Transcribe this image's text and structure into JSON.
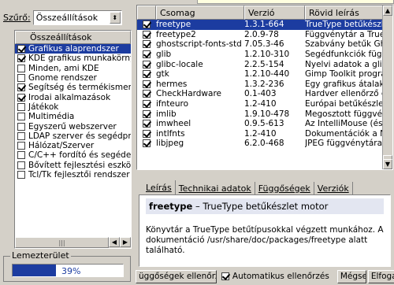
{
  "filter": {
    "label": "Szűrő:",
    "selected": "Összeállítások"
  },
  "groups": {
    "header": "Összeállítások",
    "items": [
      {
        "label": "Grafikus alaprendszer",
        "checked": true,
        "selected": true
      },
      {
        "label": "KDE grafikus munkakörnyezet",
        "checked": true,
        "selected": false
      },
      {
        "label": "Minden, ami KDE",
        "checked": false,
        "selected": false
      },
      {
        "label": "Gnome rendszer",
        "checked": false,
        "selected": false
      },
      {
        "label": "Segítség és termékismertető",
        "checked": true,
        "selected": false
      },
      {
        "label": "Irodai alkalmazások",
        "checked": true,
        "selected": false
      },
      {
        "label": "Játékok",
        "checked": false,
        "selected": false
      },
      {
        "label": "Multimédia",
        "checked": false,
        "selected": false
      },
      {
        "label": "Egyszerű webszerver",
        "checked": false,
        "selected": false
      },
      {
        "label": "LDAP szerver és segédprogramok",
        "checked": false,
        "selected": false
      },
      {
        "label": "Hálózat/Szerver",
        "checked": false,
        "selected": false
      },
      {
        "label": "C/C++ fordító és segédeszközök",
        "checked": false,
        "selected": false
      },
      {
        "label": "Bővített fejlesztési eszközök",
        "checked": false,
        "selected": false
      },
      {
        "label": "Tcl/Tk fejlesztői rendszer",
        "checked": false,
        "selected": false
      }
    ]
  },
  "disk": {
    "label": "Lemezterület",
    "percent": 39,
    "text": "39%"
  },
  "packages": {
    "columns": [
      "Csomag",
      "Verzió",
      "Rövid leírás"
    ],
    "rows": [
      {
        "name": "freetype",
        "version": "1.3.1-664",
        "desc": "TrueType betűkészlet",
        "checked": true,
        "selected": true
      },
      {
        "name": "freetype2",
        "version": "2.0.9-78",
        "desc": "Függvénytár a TrueType",
        "checked": true,
        "selected": false
      },
      {
        "name": "ghostscript-fonts-std",
        "version": "7.05.3-46",
        "desc": "Szabvány betűk Gh",
        "checked": true,
        "selected": false
      },
      {
        "name": "glib",
        "version": "1.2.10-310",
        "desc": "Segédfunkciók függ",
        "checked": true,
        "selected": false
      },
      {
        "name": "glibc-locale",
        "version": "2.2.5-154",
        "desc": "Nyelvi adatok a glib",
        "checked": true,
        "selected": false
      },
      {
        "name": "gtk",
        "version": "1.2.10-440",
        "desc": "Gimp Toolkit progra",
        "checked": true,
        "selected": false
      },
      {
        "name": "hermes",
        "version": "1.3.2-236",
        "desc": "Egy grafikus átalak",
        "checked": true,
        "selected": false
      },
      {
        "name": "CheckHardware",
        "version": "0.1-403",
        "desc": "Hardver ellenőrző e",
        "checked": true,
        "selected": false
      },
      {
        "name": "ifnteuro",
        "version": "1.2-410",
        "desc": "Európai betűkészlet",
        "checked": true,
        "selected": false
      },
      {
        "name": "imlib",
        "version": "1.9.10-478",
        "desc": "Megosztott függvén",
        "checked": true,
        "selected": false
      },
      {
        "name": "imwheel",
        "version": "0.9.5-613",
        "desc": "Az IntelliMouse (és",
        "checked": true,
        "selected": false
      },
      {
        "name": "intlfnts",
        "version": "1.2-410",
        "desc": "Dokumentációk a N",
        "checked": true,
        "selected": false
      },
      {
        "name": "libjpeg",
        "version": "6.2.0-468",
        "desc": "JPEG függvénytára",
        "checked": true,
        "selected": false
      }
    ]
  },
  "tabs": [
    {
      "label": "Leírás",
      "active": true
    },
    {
      "label": "Technikai adatok",
      "active": false
    },
    {
      "label": "Függőségek",
      "active": false
    },
    {
      "label": "Verziók",
      "active": false
    }
  ],
  "description": {
    "name": "freetype",
    "summary": " – TrueType betűkészlet motor",
    "body": "Könyvtár a TrueType betűtípusokkal végzett munkához. A dokumentáció /usr/share/doc/packages/freetype alatt található."
  },
  "bottom": {
    "check_deps_label": "üggőségek ellenőrzé",
    "auto_check_label": "Automatikus ellenőrzés",
    "auto_check_on": true,
    "cancel_label": "Mégsem",
    "accept_label": "Elfogad"
  }
}
